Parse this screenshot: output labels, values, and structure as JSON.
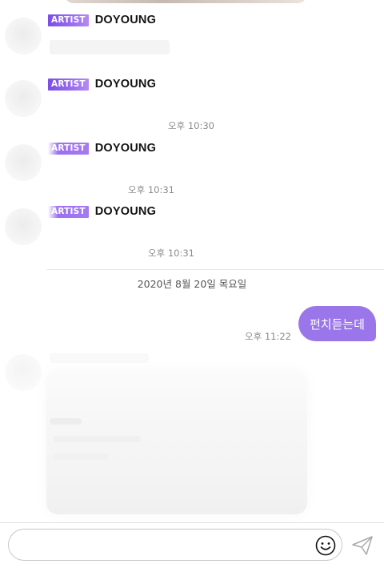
{
  "messages": [
    {
      "badge": "ARTIST",
      "name": "DOYOUNG"
    },
    {
      "badge": "ARTIST",
      "name": "DOYOUNG"
    },
    {
      "badge": "ARTIST",
      "name": "DOYOUNG",
      "time": "오후 10:30"
    },
    {
      "badge": "ARTIST",
      "name": "DOYOUNG",
      "time": "오후 10:31"
    },
    {
      "time": "오후 10:31"
    }
  ],
  "date_divider": "2020년 8월 20일 목요일",
  "my_message": {
    "text": "펀치듣는데",
    "time": "오후 11:22"
  },
  "composer": {
    "value": "",
    "placeholder": ""
  },
  "icons": {
    "emoji": "smiley-icon",
    "send": "send-icon"
  },
  "colors": {
    "accent": "#9b76ea",
    "badge": "#7b4fe6"
  }
}
